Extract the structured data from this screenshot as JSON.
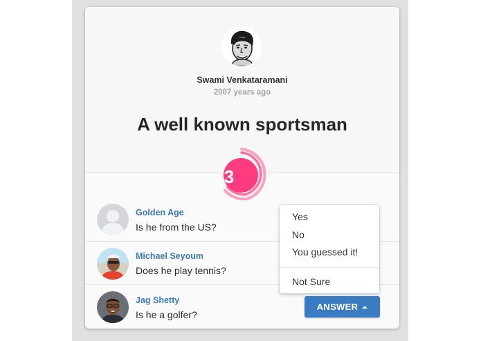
{
  "author": {
    "name": "Swami Venkataramani",
    "time": "2007 years ago"
  },
  "question": {
    "title": "A well known sportsman",
    "count": "3"
  },
  "answers": [
    {
      "name": "Golden Age",
      "text": "Is he from the US?",
      "avatar": "default-avatar-icon"
    },
    {
      "name": "Michael Seyoum",
      "text": "Does he play tennis?",
      "avatar": "user-photo"
    },
    {
      "name": "Jag Shetty",
      "text": "Is he a golfer?",
      "avatar": "user-photo"
    }
  ],
  "dropdown": {
    "options": [
      "Yes",
      "No",
      "You guessed it!",
      "Not Sure"
    ]
  },
  "answer_button": {
    "label": "ANSWER"
  },
  "colors": {
    "accent_pink": "#ff3b7f",
    "link_blue": "#3c7bbd",
    "button_blue": "#3a7cc1"
  }
}
